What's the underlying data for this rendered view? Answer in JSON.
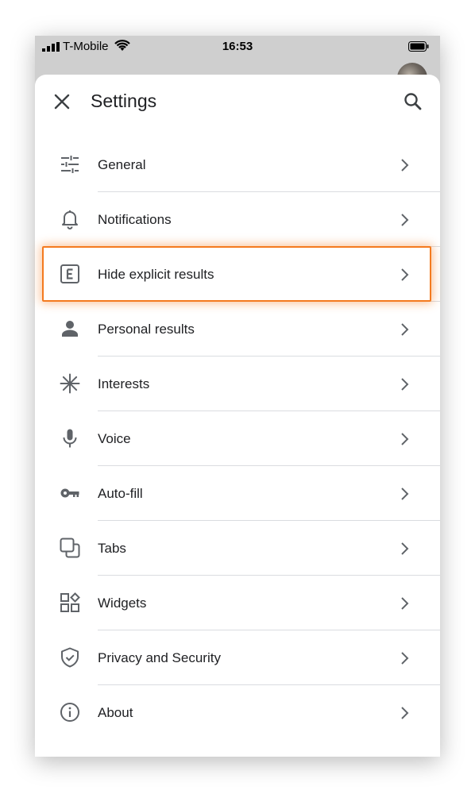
{
  "status_bar": {
    "carrier": "T-Mobile",
    "time": "16:53",
    "icons": [
      "signal-icon",
      "wifi-icon",
      "battery-icon"
    ]
  },
  "header": {
    "title": "Settings",
    "close_icon": "close-icon",
    "search_icon": "search-icon"
  },
  "menu": {
    "items": [
      {
        "label": "General",
        "icon": "tune-sliders-icon"
      },
      {
        "label": "Notifications",
        "icon": "bell-icon"
      },
      {
        "label": "Hide explicit results",
        "icon": "explicit-icon"
      },
      {
        "label": "Personal results",
        "icon": "person-icon"
      },
      {
        "label": "Interests",
        "icon": "asterisk-icon"
      },
      {
        "label": "Voice",
        "icon": "microphone-icon"
      },
      {
        "label": "Auto-fill",
        "icon": "key-icon"
      },
      {
        "label": "Tabs",
        "icon": "tabs-icon"
      },
      {
        "label": "Widgets",
        "icon": "widgets-icon"
      },
      {
        "label": "Privacy and Security",
        "icon": "shield-icon"
      },
      {
        "label": "About",
        "icon": "info-icon"
      }
    ],
    "highlighted_item": "Hide explicit results"
  },
  "colors": {
    "highlight": "#f47a1f",
    "icon": "#5f6368",
    "text": "#202124",
    "divider": "#dadce0",
    "backdrop": "#cfcfcf"
  }
}
